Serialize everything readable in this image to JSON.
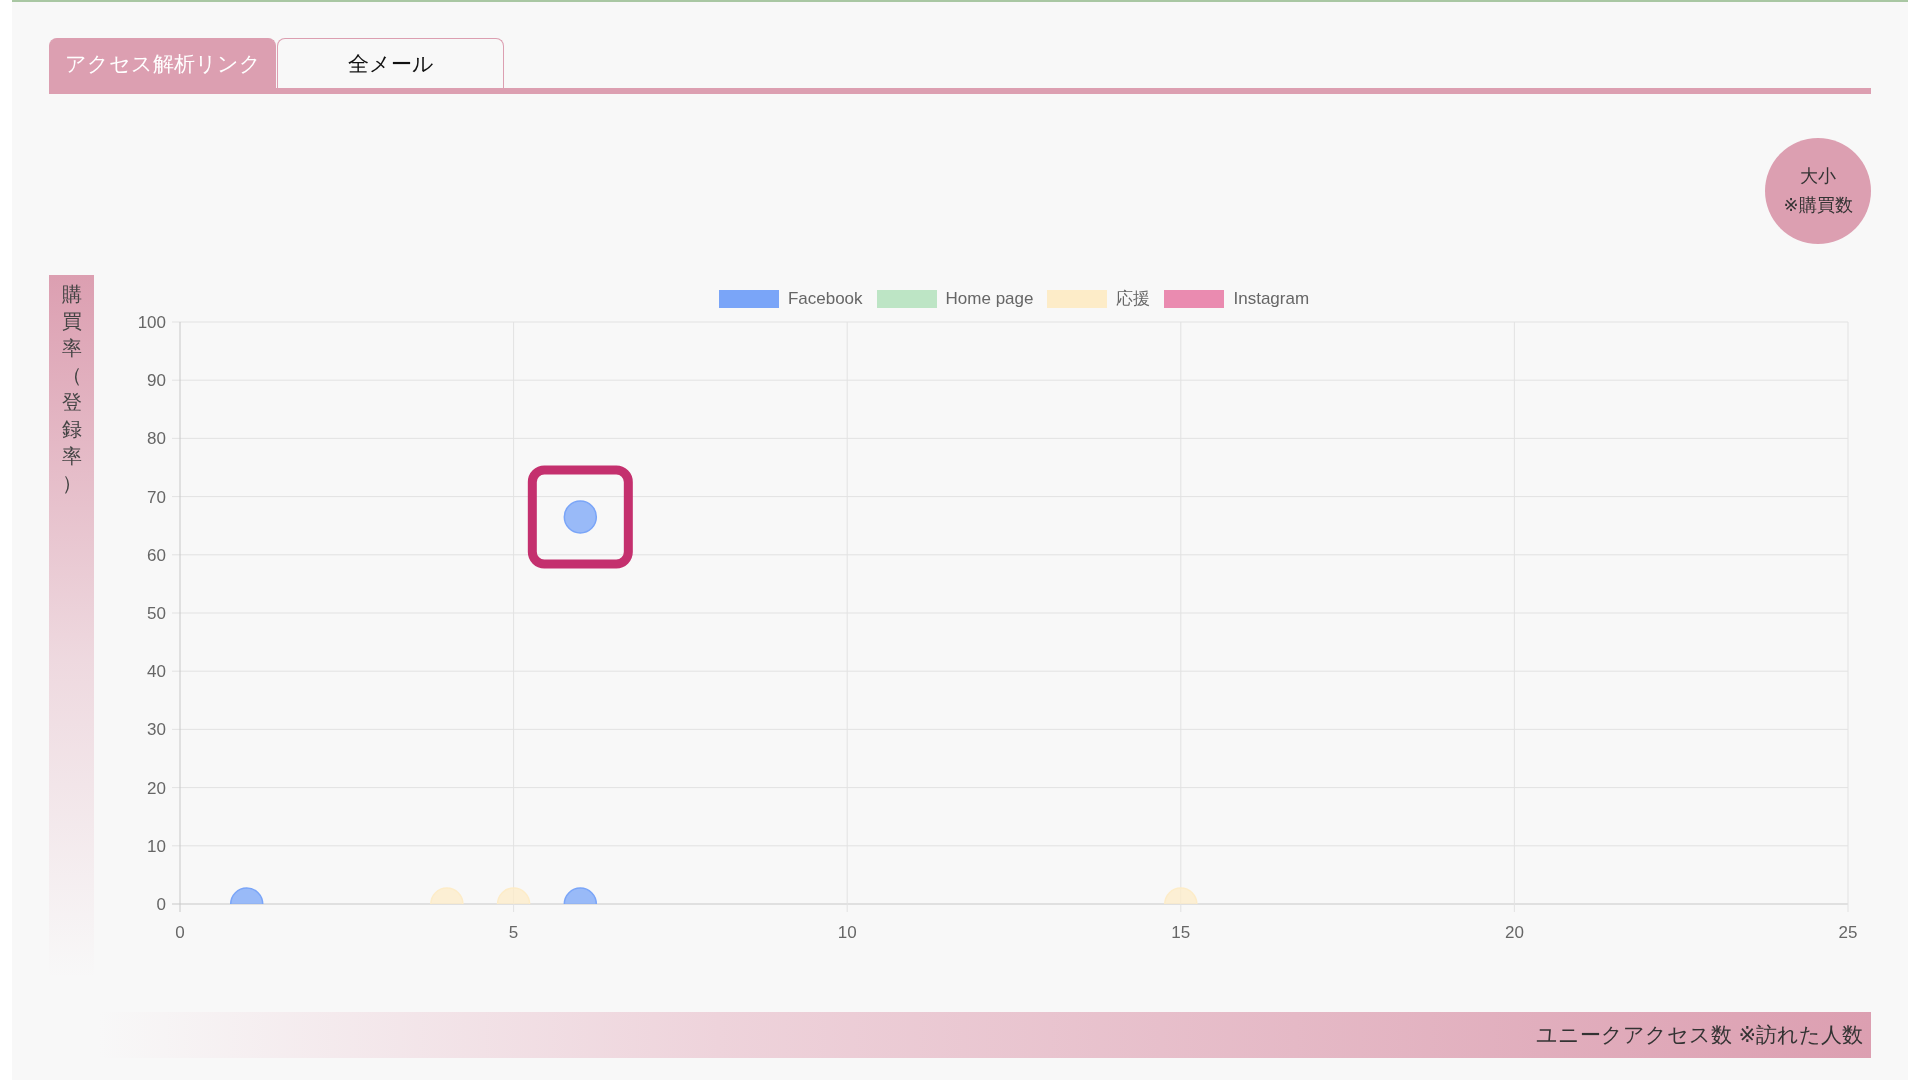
{
  "tabs": [
    {
      "label": "アクセス解析リンク",
      "selected": true
    },
    {
      "label": "全メール",
      "selected": false
    }
  ],
  "size_legend": {
    "line_1": "大小",
    "line_2": "※購買数"
  },
  "y_axis_label": "購買率（登録率）",
  "x_axis_label": "ユニークアクセス数 ※訪れた人数",
  "chart_data": {
    "type": "scatter",
    "grid": true,
    "legend": "top",
    "xlim": [
      0,
      25
    ],
    "ylim": [
      0,
      100
    ],
    "xticks": [
      0,
      5,
      10,
      15,
      20,
      25
    ],
    "yticks": [
      0,
      10,
      20,
      30,
      40,
      50,
      60,
      70,
      80,
      90,
      100
    ],
    "series": [
      {
        "name": "Facebook",
        "color": "#7aa5f8",
        "x": [
          1,
          6,
          6
        ],
        "values": [
          0,
          0,
          66.5
        ]
      },
      {
        "name": "Home page",
        "color": "#bde5c5"
      },
      {
        "name": "応援",
        "color": "#fdecc8",
        "x": [
          4,
          5,
          15
        ],
        "values": [
          0,
          0,
          0
        ]
      },
      {
        "name": "Instagram",
        "color": "#ea8bb0"
      }
    ]
  },
  "highlight_frame_on_top_point": true
}
